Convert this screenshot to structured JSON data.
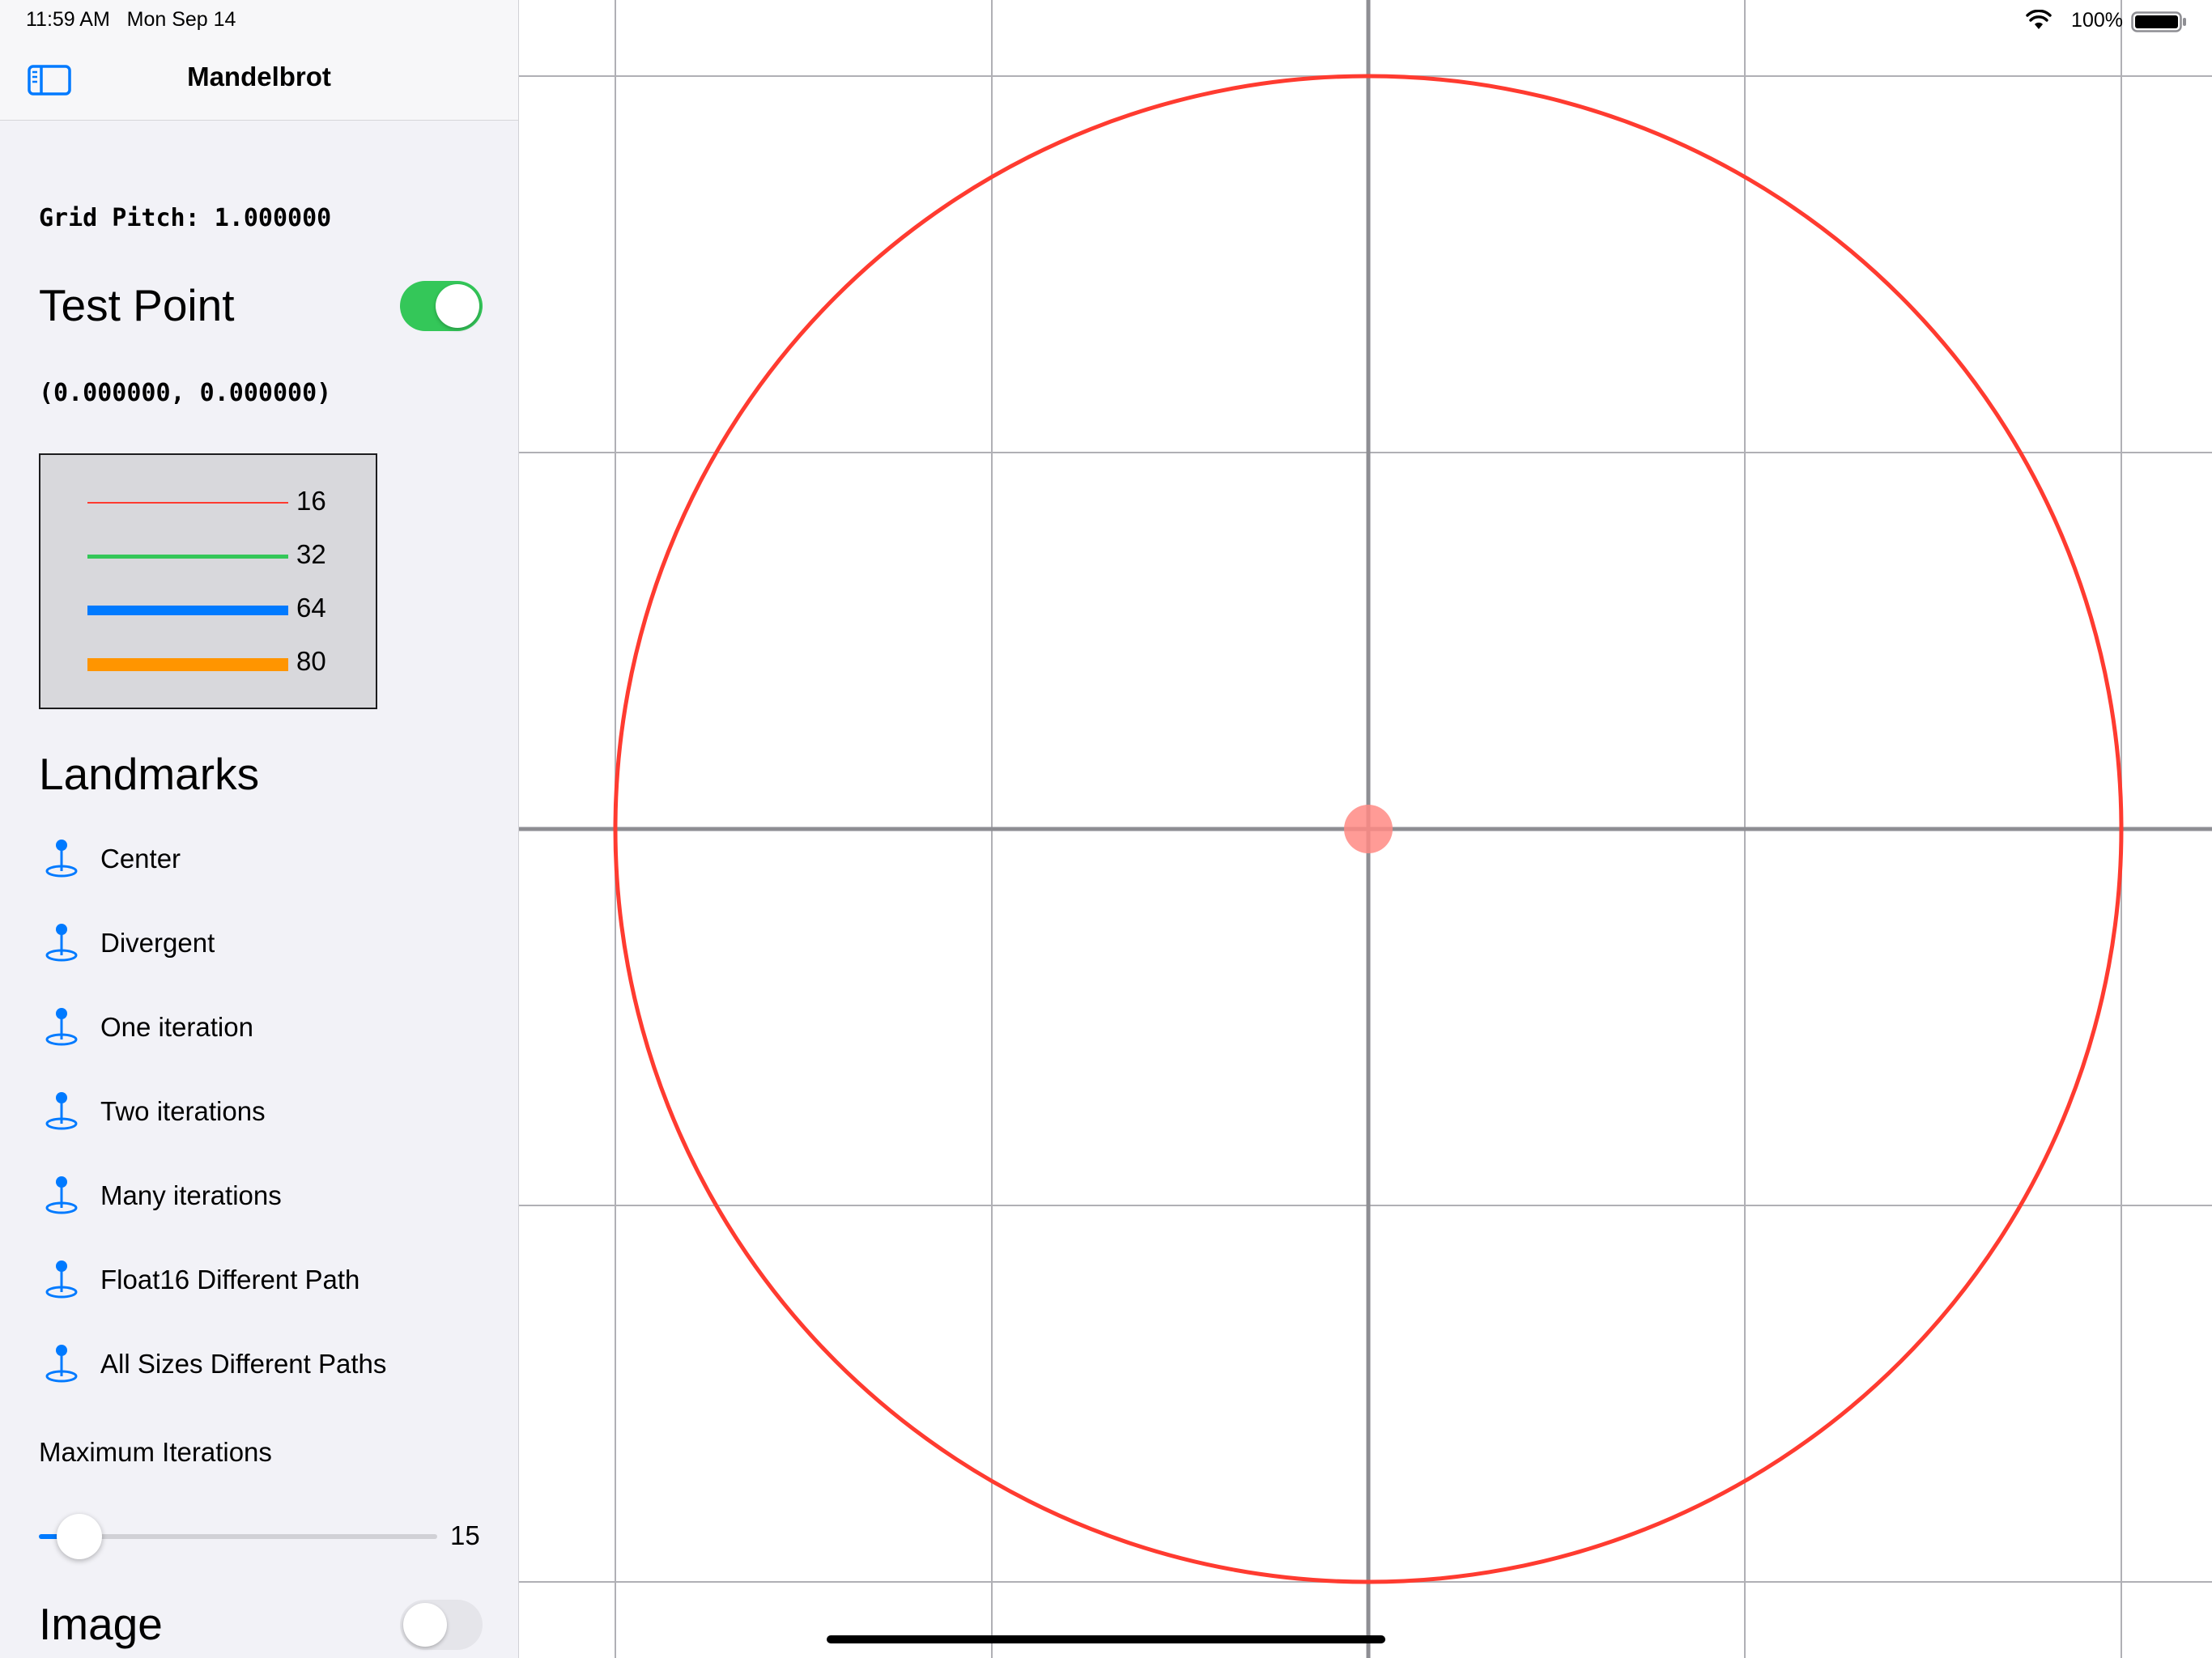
{
  "status_bar": {
    "time": "11:59 AM",
    "date": "Mon Sep 14",
    "battery": "100%"
  },
  "navbar": {
    "title": "Mandelbrot",
    "sidebar_icon": "sidebar-left-icon"
  },
  "grid_pitch": "Grid Pitch: 1.000000",
  "test_point": {
    "label": "Test Point",
    "enabled": true,
    "coordinates": "(0.000000, 0.000000)"
  },
  "legend": [
    {
      "value": "16",
      "color": "#ff3b30"
    },
    {
      "value": "32",
      "color": "#34c759"
    },
    {
      "value": "64",
      "color": "#007aff"
    },
    {
      "value": "80",
      "color": "#ff9500"
    }
  ],
  "landmarks": {
    "title": "Landmarks",
    "icon": "map-pin-icon",
    "items": [
      {
        "label": "Center"
      },
      {
        "label": "Divergent"
      },
      {
        "label": "One iteration"
      },
      {
        "label": "Two iterations"
      },
      {
        "label": "Many iterations"
      },
      {
        "label": "Float16 Different Path"
      },
      {
        "label": "All Sizes Different Paths"
      }
    ]
  },
  "max_iterations": {
    "label": "Maximum Iterations",
    "value": "15",
    "slider_fraction": 0.05
  },
  "image": {
    "label": "Image",
    "enabled": false
  },
  "plot": {
    "grid_lines": true,
    "test_point": [
      0,
      0
    ],
    "circle_radius": 2,
    "colors": {
      "circle": "#ff3b30",
      "test_point": "#ff8a84",
      "axis": "#8e8e93",
      "grid": "#b0b0b5"
    }
  }
}
